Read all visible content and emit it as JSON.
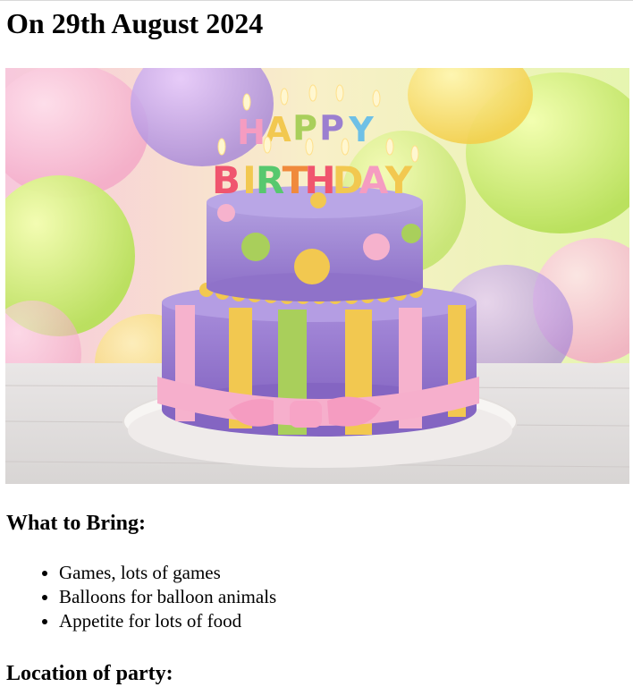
{
  "page": {
    "date_heading": "On 29th August 2024"
  },
  "hero": {
    "image_description_icon": "birthday-cake-photo",
    "candle_letters_top": [
      "H",
      "A",
      "P",
      "P",
      "Y"
    ],
    "candle_letters_bottom": [
      "B",
      "I",
      "R",
      "T",
      "H",
      "D",
      "A",
      "Y"
    ],
    "colors": {
      "purple": "#9b7fd0",
      "pink": "#f4a8c8",
      "yellow": "#f5c84a",
      "green": "#a9cf5b",
      "board": "#f4f1ef"
    }
  },
  "bring": {
    "heading": "What to Bring:",
    "items": [
      "Games, lots of games",
      "Balloons for balloon animals",
      "Appetite for lots of food"
    ]
  },
  "location": {
    "heading": "Location of party:"
  }
}
